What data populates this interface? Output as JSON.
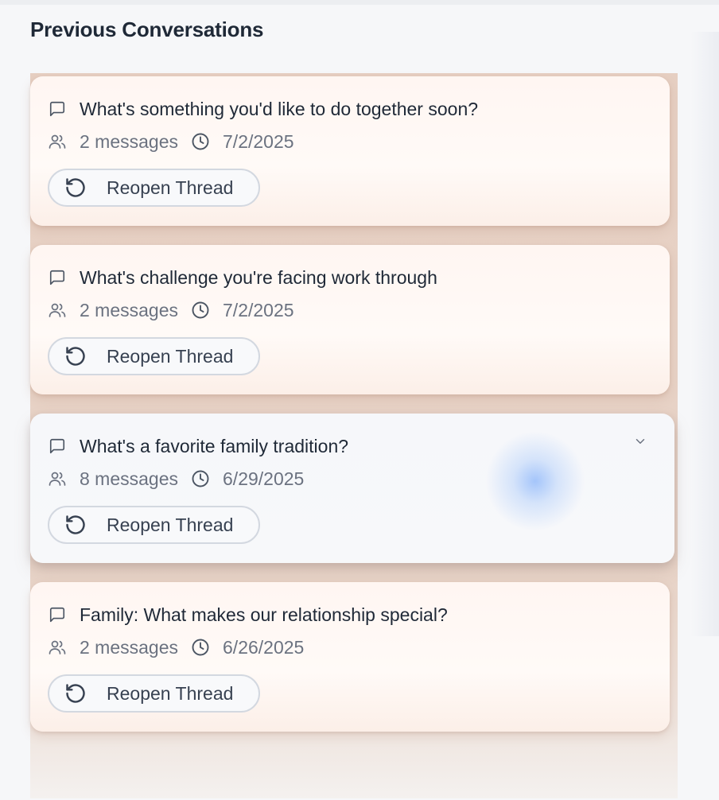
{
  "page": {
    "title": "Previous Conversations"
  },
  "conversations": [
    {
      "title": "What's something you'd like to do together soon?",
      "messages": "2 messages",
      "date": "7/2/2025",
      "action": "Reopen Thread",
      "expanded": false
    },
    {
      "title": "What's challenge you're facing work through",
      "messages": "2 messages",
      "date": "7/2/2025",
      "action": "Reopen Thread",
      "expanded": false
    },
    {
      "title": "What's a favorite family tradition?",
      "messages": "8 messages",
      "date": "6/29/2025",
      "action": "Reopen Thread",
      "expanded": false,
      "hovered": true
    },
    {
      "title": "Family: What makes our relationship special?",
      "messages": "2 messages",
      "date": "6/26/2025",
      "action": "Reopen Thread",
      "expanded": false
    }
  ],
  "icons": {
    "title": "message-square-icon",
    "messages": "users-icon",
    "date": "clock-icon",
    "action": "rotate-ccw-icon",
    "toggle": "chevron-down-icon"
  },
  "colors": {
    "background": "#f6f7f9",
    "card": "#fff6f2",
    "card_active": "#f6f7fa",
    "card_stack": "#e6cfc2",
    "text_primary": "#1f2937",
    "text_muted": "#6b7280",
    "button_border": "#d3d8e0",
    "hover_glow": "#78aafa"
  }
}
